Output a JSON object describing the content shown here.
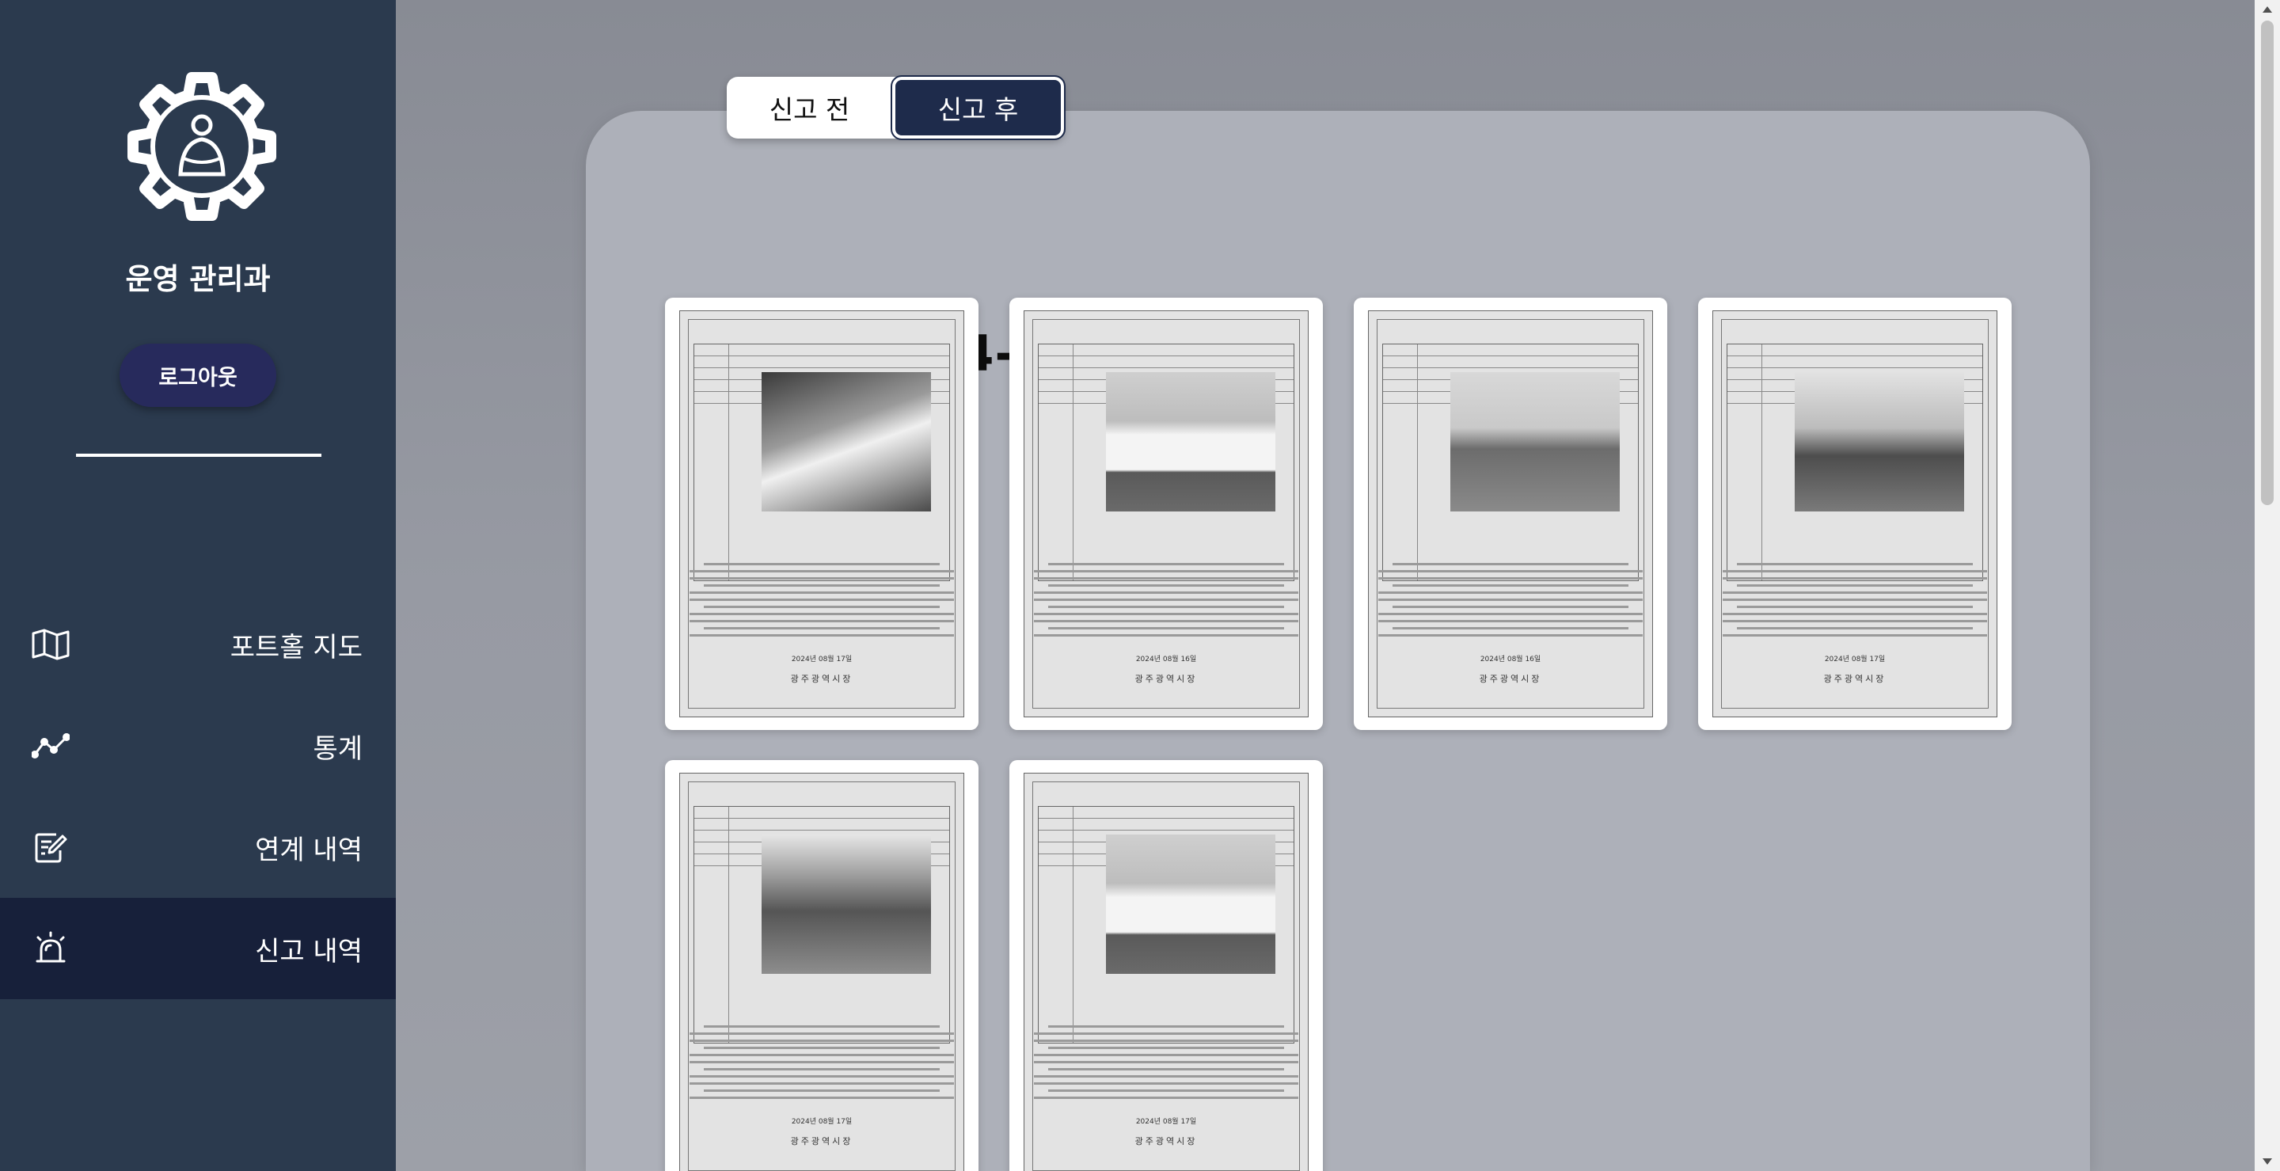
{
  "sidebar": {
    "org_name": "운영 관리과",
    "logout_label": "로그아웃",
    "nav": [
      {
        "label": "포트홀 지도",
        "icon": "map-icon"
      },
      {
        "label": "통계",
        "icon": "chart-line-icon"
      },
      {
        "label": "연계 내역",
        "icon": "edit-document-icon"
      },
      {
        "label": "신고 내역",
        "icon": "siren-icon"
      }
    ],
    "active_nav": "신고 내역"
  },
  "tabs": [
    {
      "label": "신고 전"
    },
    {
      "label": "신고 후"
    }
  ],
  "active_tab": "신고 후",
  "date_heading": "2024-08-15",
  "documents": [
    {
      "photo": "machinery close-up",
      "issue_date": "2024년 08월 17일",
      "signature": "광주광역시장"
    },
    {
      "photo": "white truck on road",
      "issue_date": "2024년 08월 16일",
      "signature": "광주광역시장"
    },
    {
      "photo": "overpass road",
      "issue_date": "2024년 08월 16일",
      "signature": "광주광역시장"
    },
    {
      "photo": "intersection with vehicles",
      "issue_date": "2024년 08월 17일",
      "signature": "광주광역시장"
    },
    {
      "photo": "city street with buildings",
      "issue_date": "2024년 08월 17일",
      "signature": "광주광역시장"
    },
    {
      "photo": "white truck on road",
      "issue_date": "2024년 08월 17일",
      "signature": "광주광역시장"
    }
  ],
  "colors": {
    "sidebar_bg": "#2b3a4e",
    "sidebar_active": "#17203a",
    "logout_bg": "#272a5c",
    "tab_active_bg": "#1e2b4b"
  }
}
